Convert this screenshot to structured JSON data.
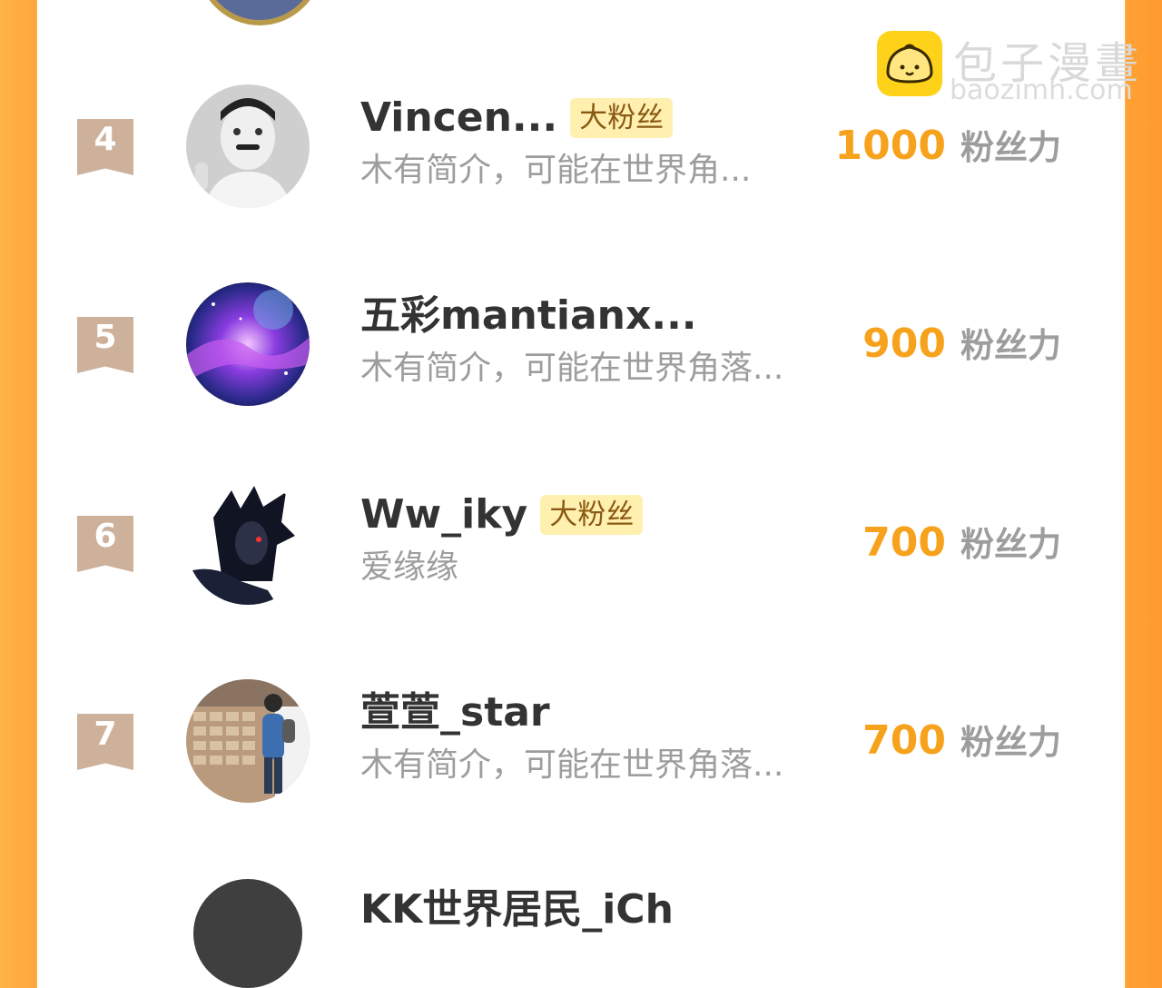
{
  "theme": {
    "accent": "#f7a21c",
    "border_orange": "#ffa63a",
    "rank_tag": "#cdb19b",
    "badge_bg": "#fff0b0",
    "badge_text": "#8a5a14",
    "name_text": "#333333",
    "muted_text": "#9d9d9d"
  },
  "watermark": {
    "title": "包子漫畫",
    "domain": "baozimh.com",
    "icon": "bun-icon"
  },
  "rows": [
    {
      "rank": "4",
      "name": "Vincen...",
      "badge": "大粉丝",
      "bio": "木有简介，可能在世界角...",
      "score": "1000",
      "unit": "粉丝力",
      "avatar": "grayscale-portrait"
    },
    {
      "rank": "5",
      "name": "五彩mantianx...",
      "badge": "",
      "bio": "木有简介，可能在世界角落...",
      "score": "900",
      "unit": "粉丝力",
      "avatar": "galaxy"
    },
    {
      "rank": "6",
      "name": "Ww_iky",
      "badge": "大粉丝",
      "bio": "爱缘缘",
      "score": "700",
      "unit": "粉丝力",
      "avatar": "anime-character"
    },
    {
      "rank": "7",
      "name": "萱萱_star",
      "badge": "",
      "bio": "木有简介，可能在世界角落...",
      "score": "700",
      "unit": "粉丝力",
      "avatar": "photo-person"
    }
  ],
  "next_row": {
    "name": "KK世界居民_iCh"
  }
}
